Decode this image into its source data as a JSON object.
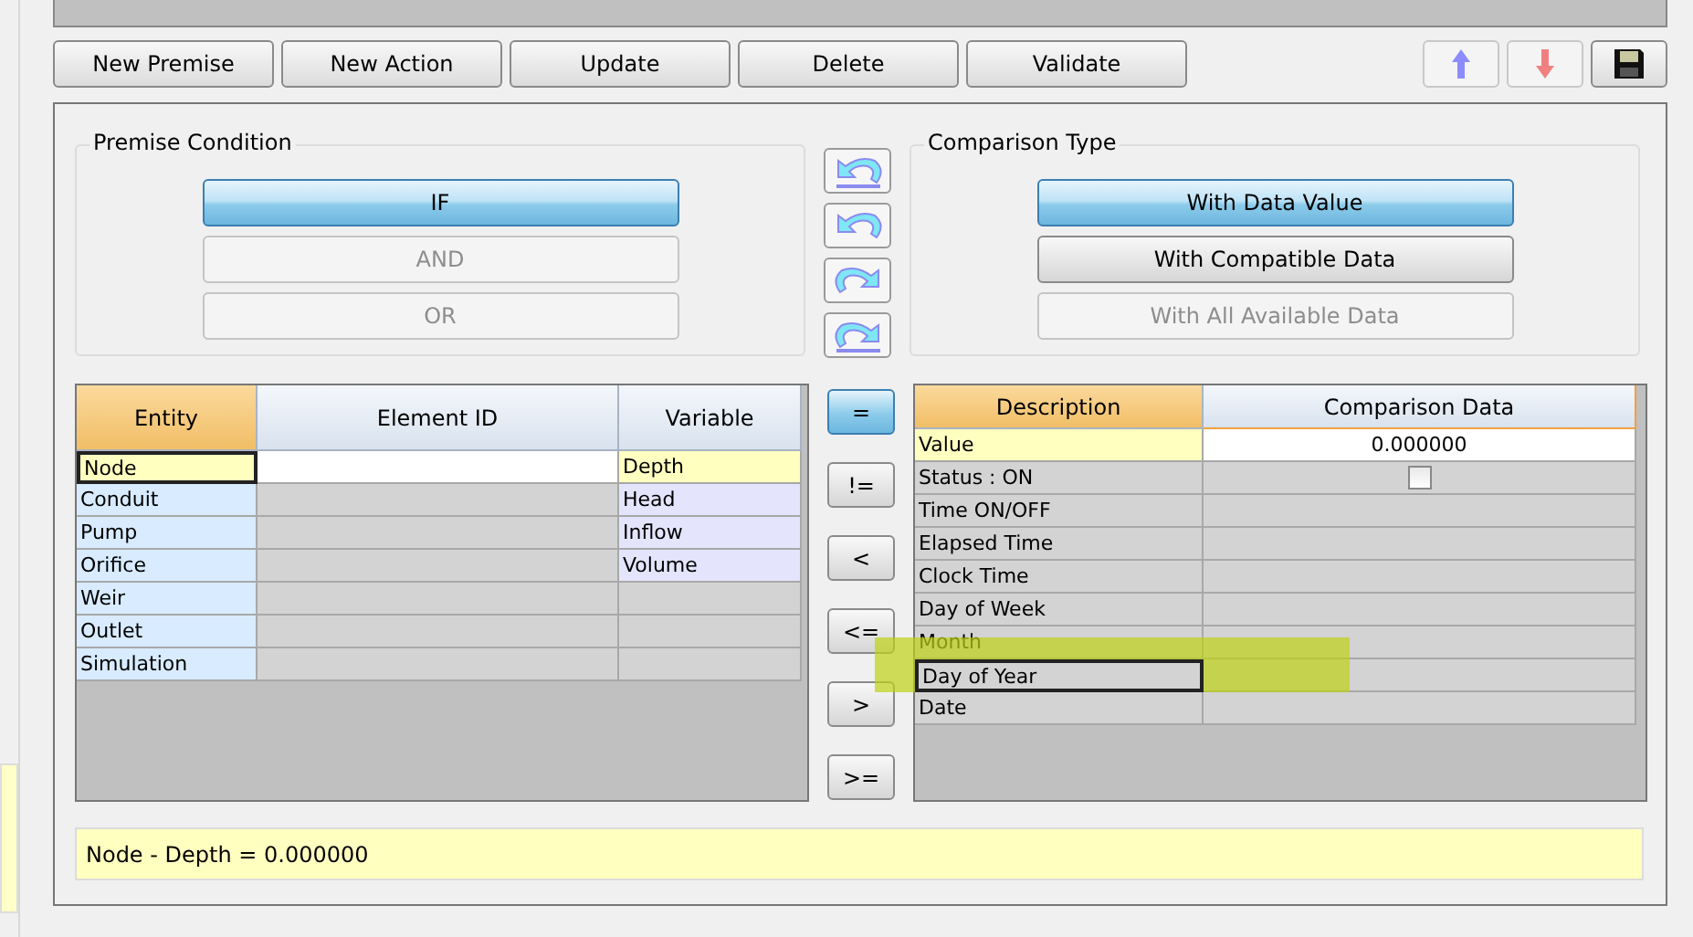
{
  "toolbar": {
    "buttons": [
      "New Premise",
      "New Action",
      "Update",
      "Delete",
      "Validate"
    ],
    "icon_buttons": [
      {
        "kind": "up",
        "disabled": true
      },
      {
        "kind": "down",
        "disabled": true
      },
      {
        "kind": "save",
        "disabled": false
      }
    ]
  },
  "premise_condition": {
    "title": "Premise Condition",
    "options": [
      {
        "label": "IF",
        "selected": true,
        "disabled": false
      },
      {
        "label": "AND",
        "selected": false,
        "disabled": true
      },
      {
        "label": "OR",
        "selected": false,
        "disabled": true
      }
    ]
  },
  "move_buttons": [
    {
      "kind": "top"
    },
    {
      "kind": "up"
    },
    {
      "kind": "down"
    },
    {
      "kind": "bottom"
    }
  ],
  "comparison_type": {
    "title": "Comparison Type",
    "options": [
      {
        "label": "With Data Value",
        "selected": true,
        "disabled": false
      },
      {
        "label": "With Compatible Data",
        "selected": false,
        "disabled": false
      },
      {
        "label": "With All Available Data",
        "selected": false,
        "disabled": true
      }
    ]
  },
  "entity_table": {
    "columns": [
      {
        "label": "Entity",
        "selected": true
      },
      {
        "label": "Element ID",
        "selected": false
      },
      {
        "label": "Variable",
        "selected": false
      }
    ],
    "rows": [
      {
        "entity": "Node",
        "variable": "Depth",
        "selected": true,
        "focused": true
      },
      {
        "entity": "Conduit",
        "variable": "Head",
        "selected": false,
        "focused": false
      },
      {
        "entity": "Pump",
        "variable": "Inflow",
        "selected": false,
        "focused": false
      },
      {
        "entity": "Orifice",
        "variable": "Volume",
        "selected": false,
        "focused": false
      },
      {
        "entity": "Weir",
        "selected": false,
        "focused": false
      },
      {
        "entity": "Outlet",
        "selected": false,
        "focused": false
      },
      {
        "entity": "Simulation",
        "selected": false,
        "focused": false
      }
    ]
  },
  "operators": [
    {
      "label": "=",
      "selected": true
    },
    {
      "label": "!=",
      "selected": false
    },
    {
      "label": "<",
      "selected": false
    },
    {
      "label": "<=",
      "selected": false
    },
    {
      "label": ">",
      "selected": false
    },
    {
      "label": ">=",
      "selected": false
    }
  ],
  "comparison_table": {
    "columns": [
      {
        "label": "Description",
        "selected": true
      },
      {
        "label": "Comparison Data",
        "selected": false
      }
    ],
    "rows": [
      {
        "description": "Value",
        "kind": "value",
        "value": "0.000000",
        "selected": true,
        "focused": false,
        "highlighted": false
      },
      {
        "description": "Status : ON",
        "kind": "checkbox",
        "checked": false,
        "selected": false,
        "focused": false,
        "highlighted": false
      },
      {
        "description": "Time ON/OFF",
        "kind": "empty",
        "selected": false,
        "focused": false,
        "highlighted": false
      },
      {
        "description": "Elapsed Time",
        "kind": "empty",
        "selected": false,
        "focused": false,
        "highlighted": false
      },
      {
        "description": "Clock Time",
        "kind": "empty",
        "selected": false,
        "focused": false,
        "highlighted": false
      },
      {
        "description": "Day of Week",
        "kind": "empty",
        "selected": false,
        "focused": false,
        "highlighted": false
      },
      {
        "description": "Month",
        "kind": "empty",
        "selected": false,
        "focused": false,
        "highlighted": false
      },
      {
        "description": "Day of Year",
        "kind": "empty",
        "selected": false,
        "focused": true,
        "highlighted": true
      },
      {
        "description": "Date",
        "kind": "empty",
        "selected": false,
        "focused": false,
        "highlighted": false
      }
    ]
  },
  "status_text": "Node - Depth = 0.000000"
}
